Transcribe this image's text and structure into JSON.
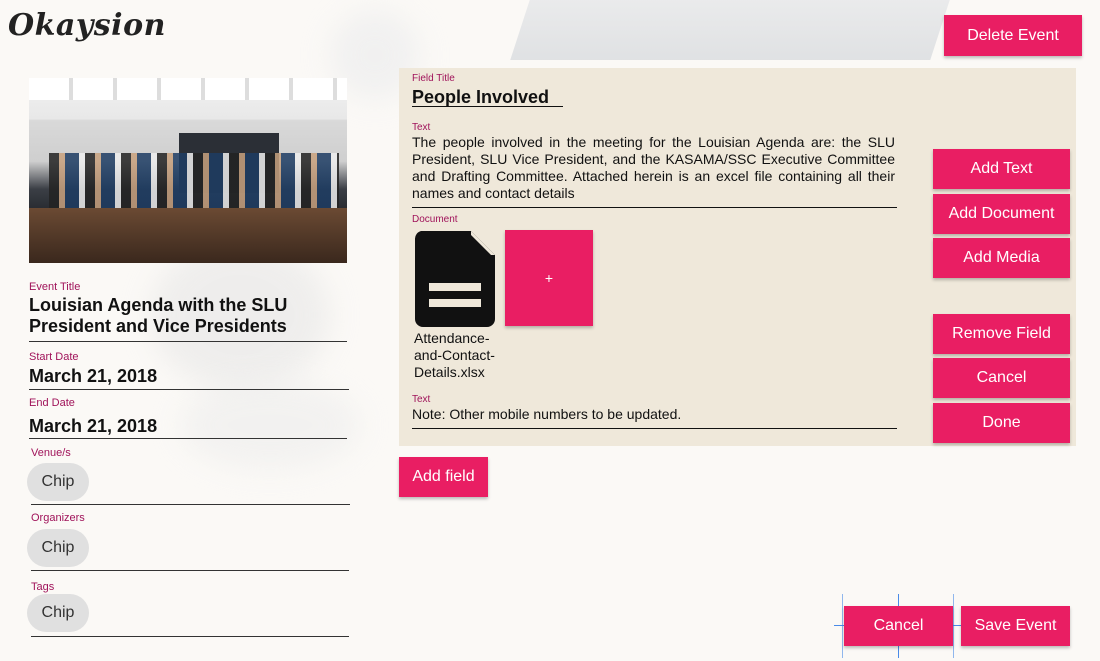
{
  "brand": {
    "logo_text": "Okaysion"
  },
  "header": {
    "delete_event_label": "Delete Event"
  },
  "event": {
    "title_label": "Event Title",
    "title": "Louisian Agenda with the SLU President and Vice Presidents",
    "start_label": "Start Date",
    "start_date": "March 21, 2018",
    "end_label": "End Date",
    "end_date": "March 21, 2018",
    "venues_label": "Venue/s",
    "venue_chip": "Chip",
    "organizers_label": "Organizers",
    "organizer_chip": "Chip",
    "tags_label": "Tags",
    "tag_chip": "Chip"
  },
  "field": {
    "title_label": "Field Title",
    "title": "People Involved",
    "text1_label": "Text",
    "text1": "The people involved in the meeting for the Louisian Agenda are: the SLU President, SLU Vice President, and the KASAMA/SSC Executive Committee and Drafting Committee. Attached herein is an excel file containing all their names and contact details",
    "document_label": "Document",
    "document_name": "Attendance-and-Contact-Details.xlsx",
    "add_document_plus": "+",
    "text2_label": "Text",
    "text2": "Note: Other mobile numbers to be updated."
  },
  "side_actions": {
    "add_text": "Add Text",
    "add_document": "Add Document",
    "add_media": "Add Media",
    "remove_field": "Remove Field",
    "cancel": "Cancel",
    "done": "Done"
  },
  "footer": {
    "add_field": "Add field",
    "cancel": "Cancel",
    "save_event": "Save Event"
  },
  "colors": {
    "accent": "#e91e63",
    "label": "#a0135a",
    "panel": "#efe8da"
  }
}
